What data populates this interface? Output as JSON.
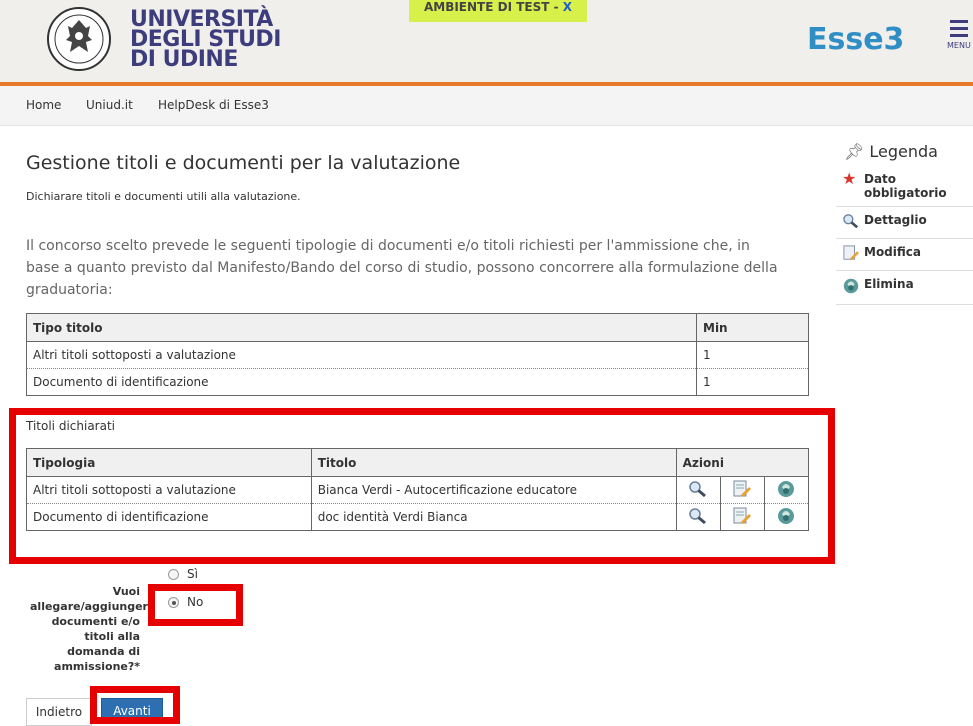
{
  "header": {
    "university_lines": [
      "UNIVERSITÀ",
      "DEGLI STUDI",
      "DI UDINE"
    ],
    "env_banner_text": "AMBIENTE DI TEST - ",
    "env_banner_x": "X",
    "app_name": "Esse3",
    "menu_label": "MENU"
  },
  "nav": {
    "links": [
      "Home",
      "Uniud.it",
      "HelpDesk di Esse3"
    ]
  },
  "main": {
    "title": "Gestione titoli e documenti per la valutazione",
    "subtitle": "Dichiarare titoli e documenti utili alla valutazione.",
    "intro": "Il concorso scelto prevede le seguenti tipologie di documenti e/o titoli richiesti per l'ammissione che, in base a quanto previsto dal Manifesto/Bando del corso di studio, possono concorrere alla formulazione della graduatoria:",
    "required_table": {
      "headers": [
        "Tipo titolo",
        "Min"
      ],
      "rows": [
        [
          "Altri titoli sottoposti a valutazione",
          "1"
        ],
        [
          "Documento di identificazione",
          "1"
        ]
      ]
    },
    "declared_label": "Titoli dichiarati",
    "declared_table": {
      "headers": [
        "Tipologia",
        "Titolo",
        "Azioni"
      ],
      "rows": [
        [
          "Altri titoli sottoposti a valutazione",
          "Bianca Verdi - Autocertificazione educatore"
        ],
        [
          "Documento di identificazione",
          "doc identità Verdi Bianca"
        ]
      ]
    }
  },
  "legend": {
    "title": "Legenda",
    "items": [
      {
        "icon": "asterisk-icon",
        "label": "Dato obbligatorio"
      },
      {
        "icon": "magnifier-icon",
        "label": "Dettaglio"
      },
      {
        "icon": "edit-icon",
        "label": "Modifica"
      },
      {
        "icon": "delete-icon",
        "label": "Elimina"
      }
    ]
  },
  "form": {
    "question": "Vuoi allegare/aggiungere documenti e/o titoli alla domanda di ammissione?*",
    "options": [
      "Sì",
      "No"
    ],
    "selected": "No",
    "back_label": "Indietro",
    "next_label": "Avanti"
  },
  "colors": {
    "header_bg": "#f1efeb",
    "accent_orange": "#e87a2b",
    "brand_blue": "#3d3d7e",
    "esse3_blue": "#2f8ec6",
    "highlight_red": "#e60000",
    "primary_button": "#2d6fb0"
  }
}
